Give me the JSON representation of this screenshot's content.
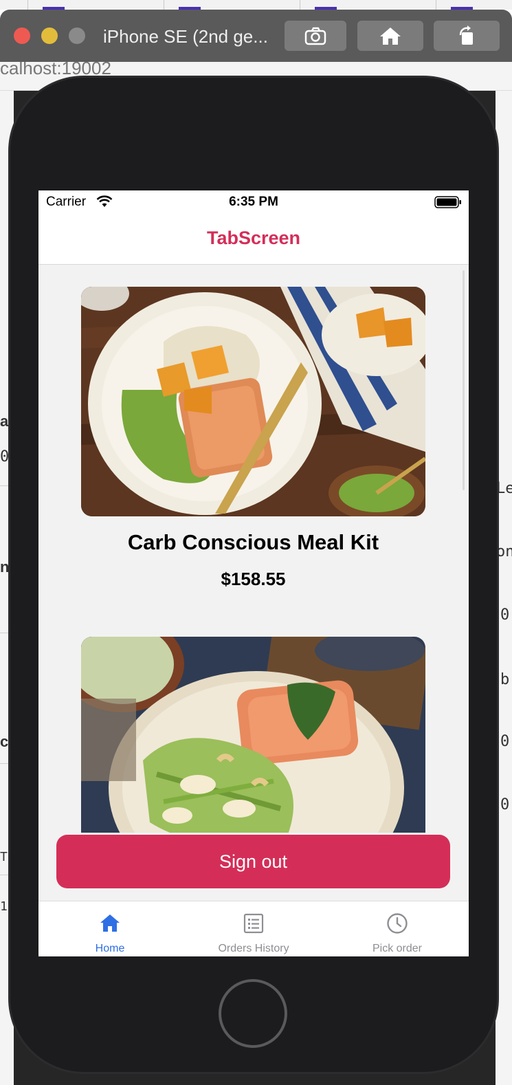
{
  "browser": {
    "url_fragment": "calhost:19002"
  },
  "simulator": {
    "title": "iPhone SE (2nd ge...",
    "buttons": [
      {
        "icon": "camera-icon"
      },
      {
        "icon": "home-icon"
      },
      {
        "icon": "rotate-icon"
      }
    ]
  },
  "status_bar": {
    "carrier": "Carrier",
    "time": "6:35 PM"
  },
  "header": {
    "title": "TabScreen",
    "title_color": "#d42e58"
  },
  "meals": [
    {
      "name": "Carb Conscious Meal Kit",
      "price": "$158.55",
      "image": "salmon-fennel-orange-plate"
    },
    {
      "name": "",
      "price": "",
      "image": "salmon-pear-salad-plate"
    }
  ],
  "actions": {
    "sign_out_label": "Sign out",
    "accent": "#d42e58"
  },
  "tabs": [
    {
      "label": "Home",
      "icon": "home-icon",
      "active": true,
      "color": "#2f6fe4"
    },
    {
      "label": "Orders History",
      "icon": "list-icon",
      "active": false,
      "color": "#8e8e93"
    },
    {
      "label": "Pick order",
      "icon": "clock-icon",
      "active": false,
      "color": "#8e8e93"
    }
  ],
  "background_page_fragments": [
    "a",
    "0",
    "Le",
    "n",
    "on",
    "0",
    "b",
    "c",
    "0",
    "0",
    "Tu",
    "1"
  ]
}
